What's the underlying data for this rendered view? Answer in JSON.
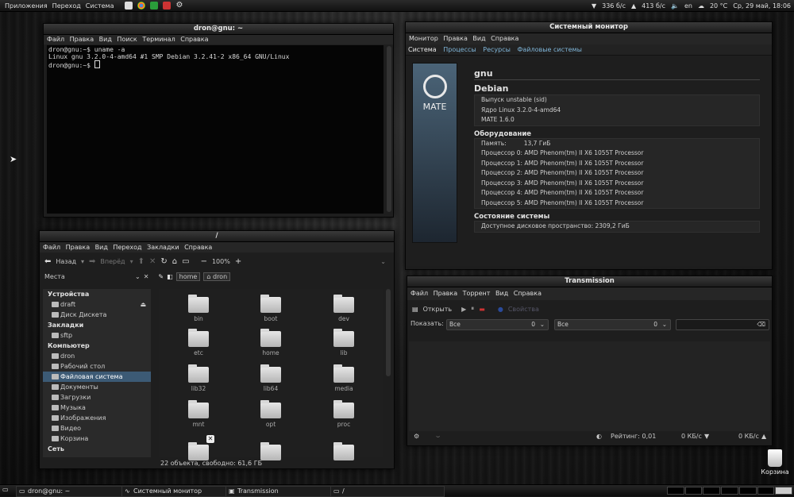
{
  "topbar": {
    "menus": [
      "Приложения",
      "Переход",
      "Система"
    ],
    "net_down": "336 б/с",
    "net_up": "413 б/с",
    "lang": "en",
    "temp": "20 °C",
    "datetime": "Ср, 29 май, 18:06"
  },
  "terminal": {
    "title": "dron@gnu: ~",
    "menu": [
      "Файл",
      "Правка",
      "Вид",
      "Поиск",
      "Терминал",
      "Справка"
    ],
    "lines": [
      "dron@gnu:~$ uname -a",
      "Linux gnu 3.2.0-4-amd64 #1 SMP Debian 3.2.41-2 x86_64 GNU/Linux",
      "dron@gnu:~$ "
    ]
  },
  "sysmon": {
    "title": "Системный монитор",
    "menu": [
      "Монитор",
      "Правка",
      "Вид",
      "Справка"
    ],
    "tabs": [
      "Система",
      "Процессы",
      "Ресурсы",
      "Файловые системы"
    ],
    "logo_text": "MATE",
    "hostname": "gnu",
    "distro": "Debian",
    "release": "Выпуск unstable (sid)",
    "kernel": "Ядро Linux 3.2.0-4-amd64",
    "mate": "MATE 1.6.0",
    "hw_title": "Оборудование",
    "mem_label": "Память:",
    "mem_value": "13,7 ГиБ",
    "cpus": [
      "Процессор 0: AMD Phenom(tm) II X6 1055T Processor",
      "Процессор 1: AMD Phenom(tm) II X6 1055T Processor",
      "Процессор 2: AMD Phenom(tm) II X6 1055T Processor",
      "Процессор 3: AMD Phenom(tm) II X6 1055T Processor",
      "Процессор 4: AMD Phenom(tm) II X6 1055T Processor",
      "Процессор 5: AMD Phenom(tm) II X6 1055T Processor"
    ],
    "status_title": "Состояние системы",
    "disk": "Доступное дисковое пространство: 2309,2 ГиБ"
  },
  "fm": {
    "title": "/",
    "menu": [
      "Файл",
      "Правка",
      "Вид",
      "Переход",
      "Закладки",
      "Справка"
    ],
    "back": "Назад",
    "forward": "Вперёд",
    "zoom": "100%",
    "places_label": "Места",
    "crumbs": [
      "home",
      "dron"
    ],
    "sections": {
      "devices": "Устройства",
      "bookmarks": "Закладки",
      "computer": "Компьютер",
      "network": "Сеть"
    },
    "devices": [
      "draft",
      "Диск Дискета"
    ],
    "bookmarks": [
      "sftp"
    ],
    "computer": [
      "dron",
      "Рабочий стол",
      "Файловая система",
      "Документы",
      "Загрузки",
      "Музыка",
      "Изображения",
      "Видео",
      "Корзина"
    ],
    "folders": [
      "bin",
      "boot",
      "dev",
      "etc",
      "home",
      "lib",
      "lib32",
      "lib64",
      "media",
      "mnt",
      "opt",
      "proc",
      "",
      "",
      ""
    ],
    "status": "22 объекта, свободно: 61,6 ГБ"
  },
  "transmission": {
    "title": "Transmission",
    "menu": [
      "Файл",
      "Правка",
      "Торрент",
      "Вид",
      "Справка"
    ],
    "open": "Открыть",
    "props": "Свойства",
    "show_label": "Показать:",
    "filter1": "Все",
    "filter1_count": "0",
    "filter2": "Все",
    "filter2_count": "0",
    "ratio": "Рейтинг: 0,01",
    "down": "0 КБ/с",
    "up": "0 КБ/с"
  },
  "desktop": {
    "trash_label": "Корзина"
  },
  "taskbar": {
    "tasks": [
      "dron@gnu: ~",
      "Системный монитор",
      "Transmission",
      "/"
    ]
  }
}
